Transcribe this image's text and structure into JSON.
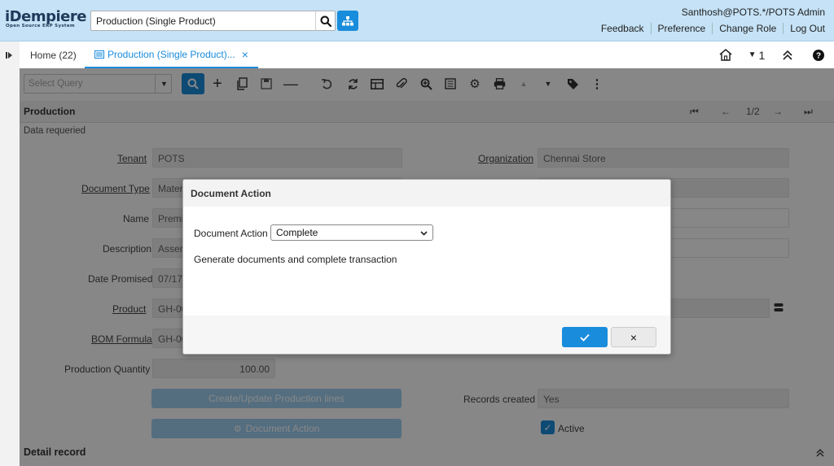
{
  "header": {
    "logo_text": "iDempiere",
    "logo_subtext": "Open Source ERP System",
    "search_value": "Production (Single Product)",
    "user": "Santhosh@POTS.*/POTS Admin",
    "links": [
      "Feedback",
      "Preference",
      "Change Role",
      "Log Out"
    ]
  },
  "tabs": {
    "home_label": "Home (22)",
    "active_label": "Production (Single Product)...",
    "close_glyph": "×",
    "history_count": "1"
  },
  "toolbar": {
    "query_placeholder": "Select Query",
    "icons": [
      "search-icon",
      "new-record-icon",
      "copy-record-icon",
      "save-icon",
      "delete-icon",
      "undo-icon",
      "refresh-icon",
      "grid-toggle-icon",
      "attachment-icon",
      "zoom-across-icon",
      "report-icon",
      "process-icon",
      "print-icon",
      "up-icon",
      "down-icon",
      "tag-icon",
      "more-icon"
    ]
  },
  "section": {
    "title": "Production",
    "record_nav": "1/2",
    "data_required": "Data requeried"
  },
  "form": {
    "tenant_label": "Tenant",
    "tenant_value": "POTS",
    "organization_label": "Organization",
    "organization_value": "Chennai Store",
    "document_type_label": "Document Type",
    "document_type_value": "Materi",
    "name_label": "Name",
    "name_value": "Premi",
    "description_label": "Description",
    "description_value": "Assem",
    "date_promised_label": "Date Promised",
    "date_promised_value": "07/17/",
    "product_label": "Product",
    "product_value": "GH-00",
    "bom_formula_label": "BOM Formula",
    "bom_formula_value": "GH-00",
    "production_quantity_label": "Production Quantity",
    "production_quantity_value": "100.00",
    "create_lines_button": "Create/Update Production lines",
    "document_action_button": "Document Action",
    "records_created_label": "Records created",
    "records_created_value": "Yes",
    "active_label": "Active",
    "detail_record_label": "Detail record"
  },
  "dialog": {
    "title": "Document Action",
    "field_label": "Document Action",
    "selected_option": "Complete",
    "description": "Generate documents and complete transaction",
    "ok_glyph": "✓",
    "cancel_glyph": "×"
  },
  "colors": {
    "header_bg": "#c5e2f6",
    "accent": "#1a8cdc",
    "overlay": "rgba(0,0,0,0.47)"
  }
}
